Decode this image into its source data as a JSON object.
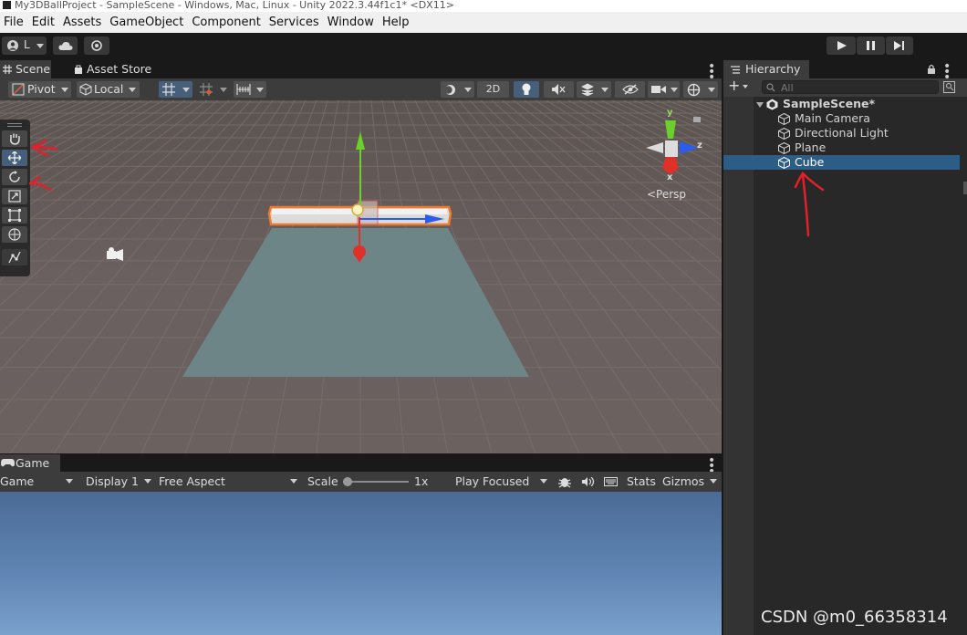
{
  "window": {
    "title": "My3DBallProject - SampleScene - Windows, Mac, Linux - Unity 2022.3.44f1c1* <DX11>"
  },
  "menu": [
    "File",
    "Edit",
    "Assets",
    "GameObject",
    "Component",
    "Services",
    "Window",
    "Help"
  ],
  "toolbar": {
    "account_label": "L",
    "cloud_icon": "cloud-icon",
    "collab_icon": "gear-icon",
    "play_icon": "play-icon",
    "pause_icon": "pause-icon",
    "step_icon": "step-icon"
  },
  "scene_panel": {
    "tabs": [
      {
        "label": "Scene",
        "icon": "grid-icon",
        "active": true
      },
      {
        "label": "Asset Store",
        "icon": "store-icon",
        "active": false
      }
    ],
    "tools": {
      "pivot_label": "Pivot",
      "local_label": "Local",
      "mode_2d_label": "2D"
    },
    "orientation": {
      "y_label": "y",
      "z_label": "z",
      "x_label": "x",
      "projection_label": "<Persp"
    },
    "selected_tool": "move"
  },
  "game_panel": {
    "tab_label": "Game",
    "tools": {
      "game_label": "Game",
      "display_label": "Display 1",
      "aspect_label": "Free Aspect",
      "scale_label": "Scale",
      "scale_value_label": "1x",
      "play_mode_label": "Play Focused",
      "stats_label": "Stats",
      "gizmos_label": "Gizmos"
    },
    "scale_value": 1
  },
  "hierarchy": {
    "tab_label": "Hierarchy",
    "add_label": "+",
    "search_placeholder": "All",
    "scene_label": "SampleScene*",
    "items": [
      {
        "label": "Main Camera"
      },
      {
        "label": "Directional Light"
      },
      {
        "label": "Plane"
      },
      {
        "label": "Cube",
        "selected": true
      }
    ]
  },
  "watermark": "CSDN @m0_66358314",
  "colors": {
    "selection": "#2c5d87",
    "annotation": "#e0202a",
    "x_axis": "#e0302a",
    "y_axis": "#6cd02a",
    "z_axis": "#2a5cf0",
    "outline": "#f0782a"
  }
}
